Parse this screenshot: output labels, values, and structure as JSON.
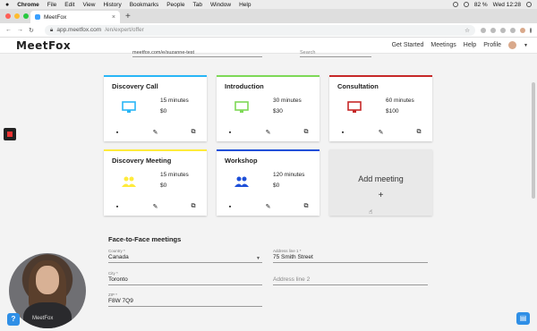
{
  "menubar": {
    "apple": "",
    "app": "Chrome",
    "items": [
      "File",
      "Edit",
      "View",
      "History",
      "Bookmarks",
      "People",
      "Tab",
      "Window",
      "Help"
    ],
    "battery": "82 %",
    "time": "Wed 12:28"
  },
  "browser": {
    "tab_title": "MeetFox",
    "url_host": "app.meetfox.com",
    "url_path": "/en/expert/offer",
    "new_tab": "+",
    "tab_close": "×"
  },
  "header": {
    "logo": "MeetFox",
    "nav": [
      "Get Started",
      "Meetings",
      "Help",
      "Profile"
    ]
  },
  "top_fields": {
    "link_value": "meetfox.com/e/suzanne-test",
    "search_placeholder": "Search"
  },
  "cards": [
    {
      "title": "Discovery Call",
      "duration": "15 minutes",
      "price": "$0",
      "accent": "#29b6f6",
      "icon": "monitor-icon"
    },
    {
      "title": "Introduction",
      "duration": "30 minutes",
      "price": "$30",
      "accent": "#7ed957",
      "icon": "monitor-icon"
    },
    {
      "title": "Consultation",
      "duration": "60 minutes",
      "price": "$100",
      "accent": "#c62828",
      "icon": "monitor-icon"
    },
    {
      "title": "Discovery Meeting",
      "duration": "15 minutes",
      "price": "$0",
      "accent": "#ffeb3b",
      "icon": "people-icon"
    },
    {
      "title": "Workshop",
      "duration": "120 minutes",
      "price": "$0",
      "accent": "#1e4fd8",
      "icon": "people-icon"
    }
  ],
  "card_actions": {
    "delete": "▪",
    "edit": "✎",
    "copy": "⧉"
  },
  "add_meeting": {
    "label": "Add meeting",
    "plus": "+"
  },
  "f2f": {
    "title": "Face-to-Face meetings",
    "country_label": "Country *",
    "country_value": "Canada",
    "address1_label": "Address line 1 *",
    "address1_value": "75 Smith Street",
    "city_label": "City *",
    "city_value": "Toronto",
    "address2_placeholder": "Address line 2",
    "zip_label": "ZIP *",
    "zip_value": "F8W 7Q9"
  },
  "video": {
    "watermark": "MeetFox"
  },
  "widgets": {
    "help": "?",
    "chat": "▤"
  }
}
